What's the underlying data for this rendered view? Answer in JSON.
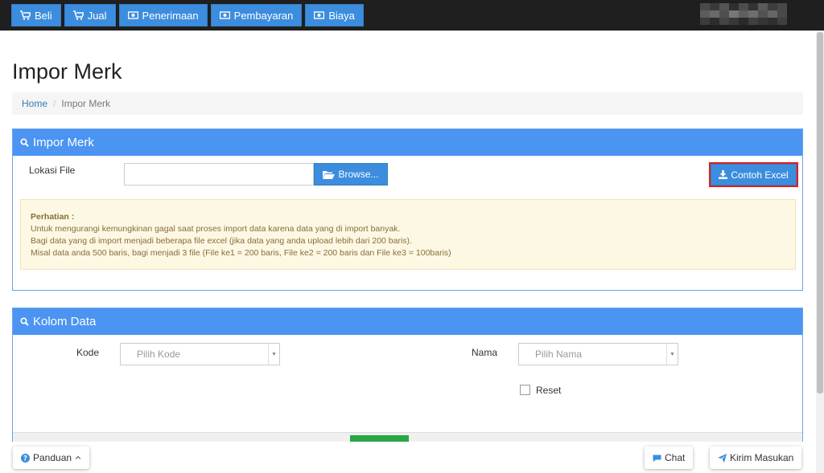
{
  "topnav": {
    "items": [
      {
        "label": "Beli",
        "icon": "cart-icon"
      },
      {
        "label": "Jual",
        "icon": "cart-icon"
      },
      {
        "label": "Penerimaan",
        "icon": "money-icon"
      },
      {
        "label": "Pembayaran",
        "icon": "money-icon"
      },
      {
        "label": "Biaya",
        "icon": "money-icon"
      }
    ]
  },
  "page": {
    "title": "Impor Merk"
  },
  "breadcrumb": {
    "home": "Home",
    "separator": "/",
    "current": "Impor Merk"
  },
  "import_panel": {
    "title": "Impor Merk",
    "file_label": "Lokasi File",
    "file_value": "",
    "browse_label": "Browse...",
    "excel_label": "Contoh Excel",
    "alert": {
      "title": "Perhatian :",
      "lines": [
        "Untuk mengurangi kemungkinan gagal saat proses import data karena data yang di import banyak.",
        "Bagi data yang di import menjadi beberapa file excel (jika data yang anda upload lebih dari 200 baris).",
        "Misal data anda 500 baris, bagi menjadi 3 file (File ke1 = 200 baris, File ke2 = 200 baris dan File ke3 = 100baris)"
      ]
    }
  },
  "kolom_panel": {
    "title": "Kolom Data",
    "kode_label": "Kode",
    "kode_placeholder": "Pilih Kode",
    "nama_label": "Nama",
    "nama_placeholder": "Pilih Nama",
    "reset_label": "Reset",
    "select_arrow": "▼"
  },
  "footer": {
    "panduan_label": "Panduan",
    "chat_label": "Chat",
    "kirim_label": "Kirim Masukan"
  },
  "colors": {
    "topbar_bg": "#1f1f1f",
    "nav_button": "#3c8dde",
    "panel_heading": "#4b94f2",
    "alert_bg": "#fcf8e3",
    "alert_text": "#8a6d3b",
    "highlight_border": "#e11d1d",
    "link": "#337ab7"
  }
}
